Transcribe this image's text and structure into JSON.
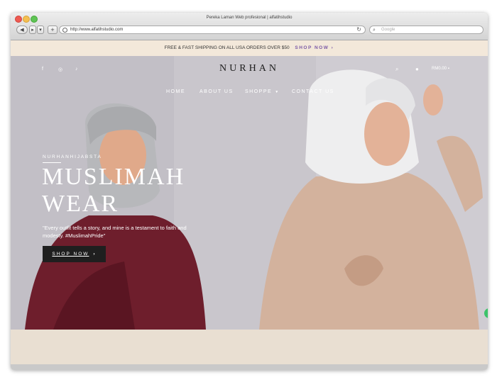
{
  "browser": {
    "window_title": "Pereka Laman Web profesional | alfatihstudio",
    "url": "http://www.alfatihstudio.com",
    "search_placeholder": "Google"
  },
  "promo": {
    "text": "FREE & FAST SHIPPING ON ALL USA ORDERS OVER $50",
    "cta": "SHOP NOW"
  },
  "header": {
    "logo": "NURHAN",
    "social": {
      "facebook": "f",
      "instagram": "◎",
      "tiktok": "♪"
    },
    "cart_total": "RM0.00"
  },
  "menu": {
    "items": [
      "HOME",
      "ABOUT US",
      "SHOPPE",
      "CONTACT US"
    ]
  },
  "hero": {
    "eyebrow": "NURHANHIJABSTA",
    "headline": "MUSLIMAH WEAR",
    "quote": "\"Every outfit tells a story, and mine is a testament to faith and modesty. #MuslimahPride\"",
    "button": "SHOP NOW"
  },
  "colors": {
    "promo_bg": "#f3e8da",
    "promo_cta": "#7b5aa6",
    "button_bg": "#1f1f1f",
    "chat_bubble": "#3cc36a"
  }
}
